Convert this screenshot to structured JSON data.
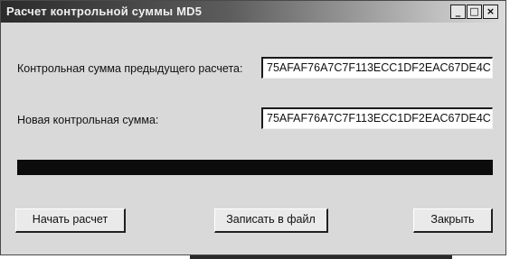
{
  "window": {
    "title": "Расчет контрольной суммы MD5",
    "buttons": {
      "minimize_icon": "minimize-icon",
      "maximize_icon": "maximize-icon",
      "close_icon": "close-icon"
    }
  },
  "form": {
    "previous_checksum_label": "Контрольная сумма предыдущего расчета:",
    "previous_checksum_value": "75AFAF76A7C7F113ECC1DF2EAC67DE4C",
    "new_checksum_label": "Новая контрольная сумма:",
    "new_checksum_value": "75AFAF76A7C7F113ECC1DF2EAC67DE4C",
    "progress_fraction": 1.0
  },
  "actions": {
    "start_label": "Начать расчет",
    "save_label": "Записать в файл",
    "close_label": "Закрыть"
  },
  "colors": {
    "title_bar_start": "#2b2b2b",
    "window_background": "#d9d9d9",
    "progress_fill": "#0c0c0c"
  }
}
